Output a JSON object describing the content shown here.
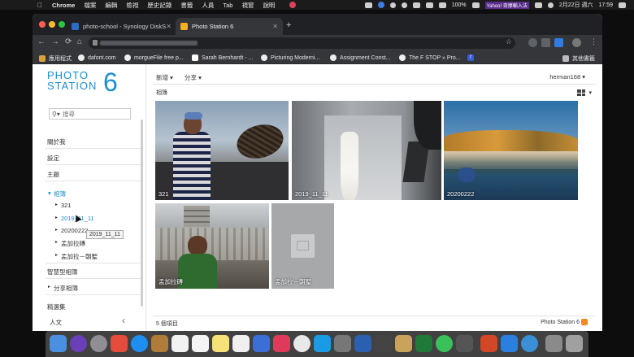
{
  "menubar": {
    "app": "Chrome",
    "items": [
      "檔案",
      "編輯",
      "檢視",
      "歷史記錄",
      "書籤",
      "人員",
      "Tab",
      "視窗",
      "說明"
    ],
    "battery": "100%",
    "yahoo": "Yahoo! 奇摩輸入法",
    "date": "2月22日 週六",
    "time": "17:59"
  },
  "browser": {
    "tabs": [
      {
        "title": "photo-school - Synology DiskS",
        "active": false
      },
      {
        "title": "Photo Station 6",
        "active": true
      }
    ],
    "new_tab": "+",
    "bookmarks": [
      "應用程式",
      "dafont.com",
      "morgueFile free p...",
      "Sarah Bernhardt - ...",
      "Picturing Moderni...",
      "Assignment Const...",
      "The F STOP » Pro...",
      "f"
    ],
    "other_bookmarks": "其他書籤"
  },
  "app": {
    "logo_line1": "PHOTO",
    "logo_line2": "STATION",
    "logo_version": "6",
    "search_placeholder": "搜尋",
    "nav": {
      "about": "關於我",
      "settings": "設定",
      "theme": "主題",
      "albums": "相簿",
      "album_items": [
        "321",
        "2019_11_11",
        "20200222",
        "孟加拉磚",
        "孟加拉－朝聖"
      ],
      "smart_albums": "智慧型相簿",
      "shared_albums": "分享相簿",
      "featured": "精選集",
      "people": "人文"
    },
    "tooltip": "2019_11_11",
    "toolbar": {
      "new": "新增",
      "share": "分享",
      "user": "herman168"
    },
    "breadcrumb": "相簿",
    "albums": [
      {
        "label": "321"
      },
      {
        "label": "2019_11_11"
      },
      {
        "label": "20200222"
      },
      {
        "label": "孟加拉磚"
      },
      {
        "label": "孟加拉－朝聖"
      }
    ],
    "item_count": "5 個項目",
    "brand": "Photo Station 6"
  },
  "colors": {
    "accent": "#1a8ecf",
    "rss": "#f08a1c"
  }
}
